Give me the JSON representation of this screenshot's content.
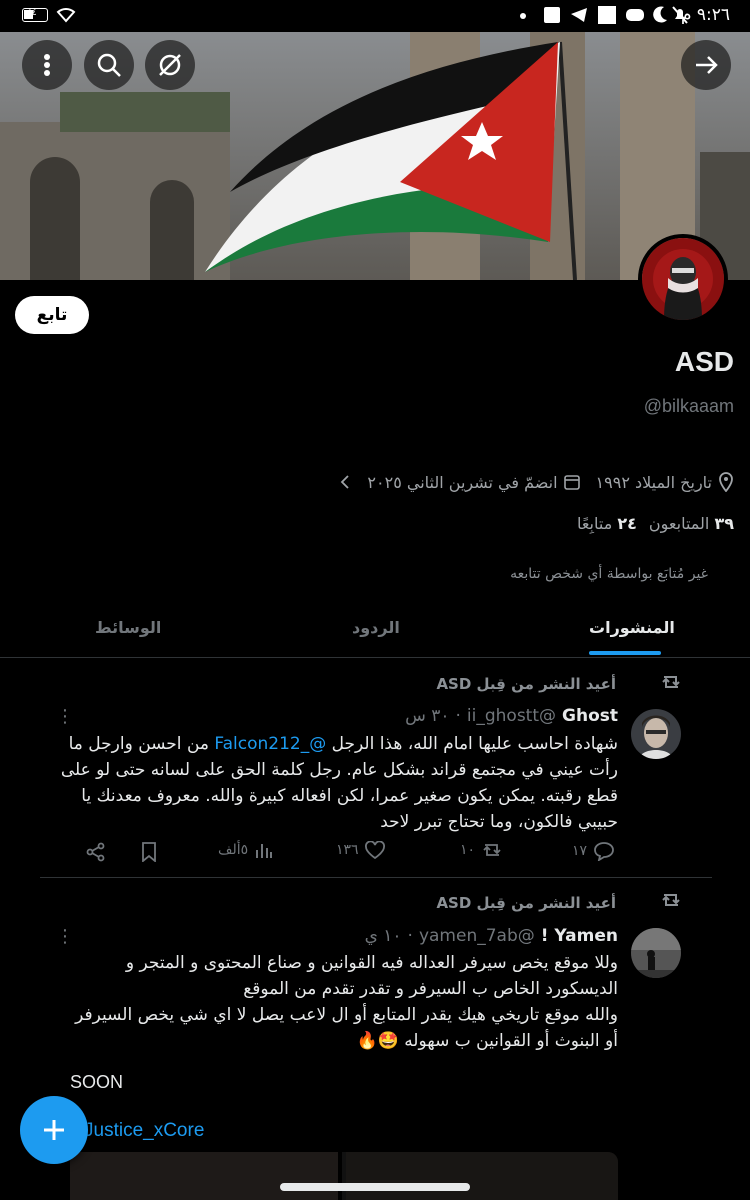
{
  "status_bar": {
    "time": "٩:٢٦ م",
    "battery": "٤٤",
    "icons": [
      "wifi-icon",
      "battery-icon",
      "facebook-icon",
      "telegram-icon",
      "square-icon",
      "discord-icon",
      "moon-icon",
      "mute-icon",
      "dot-icon"
    ]
  },
  "profile": {
    "follow_label": "تابع",
    "name": "ASD",
    "handle": "@bilkaaam",
    "birth": "تاريخ الميلاد ١٩٩٢",
    "joined": "انضمّ في تشرين الثاني ٢٠٢٥",
    "followers_count": "٣٩",
    "followers_label": "المتابعون",
    "following_count": "٢٤",
    "following_label": "متابِعًا",
    "not_followed_note": "غير مُتابَع بواسطة أي شخص تتابعه"
  },
  "tabs": [
    {
      "label": "المنشورات",
      "active": true
    },
    {
      "label": "الردود",
      "active": false
    },
    {
      "label": "الوسائط",
      "active": false
    }
  ],
  "posts": [
    {
      "repost_label": "أعيد النشر من قِبل ASD",
      "name": "Ghost",
      "handle": "@ii_ghostt",
      "time": "٣٠ س",
      "body_before": "شهادة احاسب عليها امام الله، هذا الرجل ",
      "mention": "@_Falcon212",
      "body_after": " من احسن وارجل ما رأت عيني في مجتمع قراند بشكل عام. رجل كلمة الحق على لسانه حتى لو على قطع رقبته. يمكن يكون صغير عمرا، لكن افعاله كبيرة والله. معروف معدنك يا حبيبي فالكون، وما تحتاج تبرر لاحد",
      "replies": "١٧",
      "reposts": "١٠",
      "likes": "١٣٦",
      "views": "٥ألف"
    },
    {
      "repost_label": "أعيد النشر من قِبل ASD",
      "name": "Yamen !",
      "handle": "@yamen_7ab",
      "time": "١٠ ي",
      "lines": [
        "وللا موقع يخص سيرفر العداله فيه القوانين و صناع المحتوى و المتجر و الديسكورد الخاص ب السيرفر و تقدر تقدم من الموقع",
        "والله موقع تاريخي هيك يقدر المتابع أو ال لاعب  يصل لا اي شي يخص السيرفر أو البنوث  أو القوانين  ب سهوله 🤩🔥"
      ],
      "soon": "SOON",
      "link": "Justice_xCore"
    }
  ],
  "colors": {
    "accent": "#1d9bf0",
    "background": "#000000",
    "muted": "#71767b"
  }
}
